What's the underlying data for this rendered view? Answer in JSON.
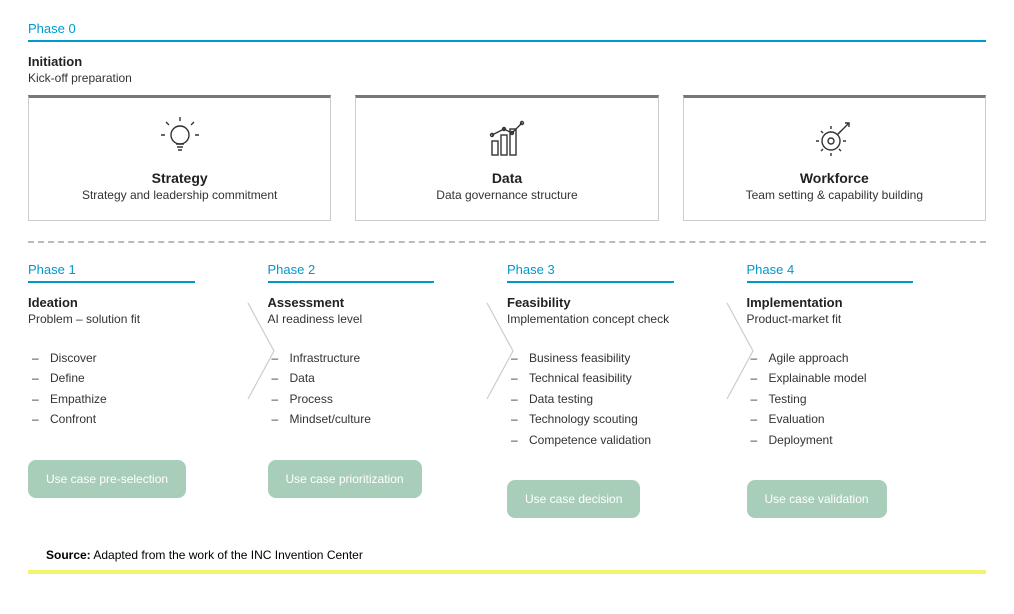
{
  "phase0": {
    "label": "Phase 0",
    "title": "Initiation",
    "subtitle": "Kick-off preparation",
    "cards": [
      {
        "title": "Strategy",
        "desc": "Strategy and leadership commitment"
      },
      {
        "title": "Data",
        "desc": "Data governance structure"
      },
      {
        "title": "Workforce",
        "desc": "Team setting & capability building"
      }
    ]
  },
  "phases": [
    {
      "label": "Phase 1",
      "title": "Ideation",
      "subtitle": "Problem – solution fit",
      "bullets": [
        "Discover",
        "Define",
        "Empathize",
        "Confront"
      ],
      "pill": "Use case pre-selection"
    },
    {
      "label": "Phase 2",
      "title": "Assessment",
      "subtitle": "AI readiness level",
      "bullets": [
        "Infrastructure",
        "Data",
        "Process",
        "Mindset/culture"
      ],
      "pill": "Use case prioritization"
    },
    {
      "label": "Phase 3",
      "title": "Feasibility",
      "subtitle": "Implementation concept check",
      "bullets": [
        "Business feasibility",
        "Technical feasibility",
        "Data testing",
        "Technology scouting",
        "Competence validation"
      ],
      "pill": "Use case decision"
    },
    {
      "label": "Phase 4",
      "title": "Implementation",
      "subtitle": "Product-market fit",
      "bullets": [
        "Agile approach",
        "Explainable model",
        "Testing",
        "Evaluation",
        "Deployment"
      ],
      "pill": "Use case validation"
    }
  ],
  "source": {
    "label": "Source:",
    "text": " Adapted from the work of the INC Invention Center"
  }
}
